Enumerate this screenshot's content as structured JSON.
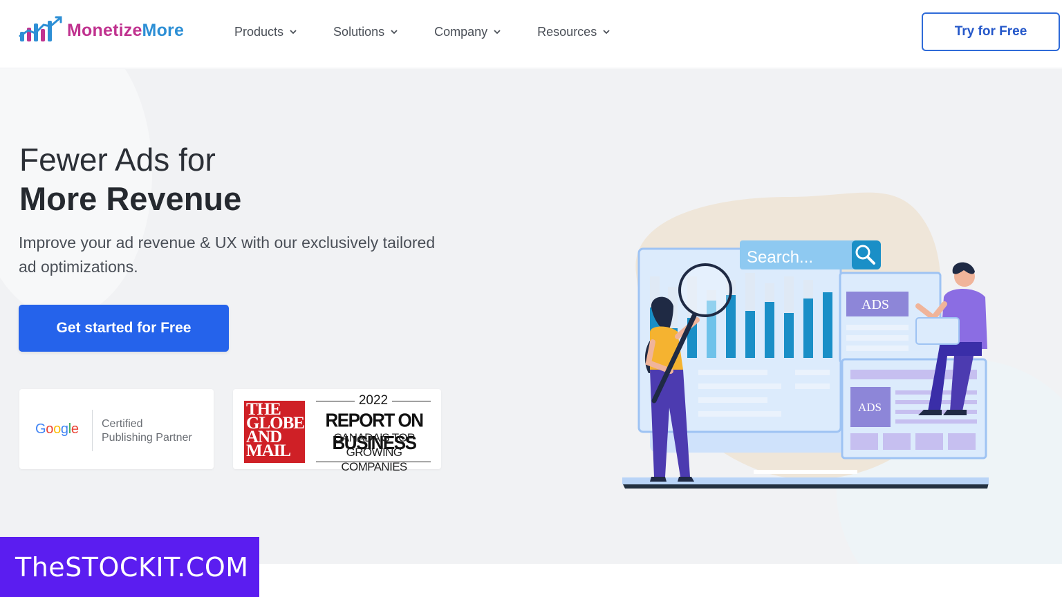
{
  "header": {
    "logo_text_a": "Monetize",
    "logo_text_b": "More",
    "nav": [
      {
        "label": "Products"
      },
      {
        "label": "Solutions"
      },
      {
        "label": "Company"
      },
      {
        "label": "Resources"
      }
    ],
    "cta_label": "Try for Free"
  },
  "hero": {
    "title_line1": "Fewer Ads for",
    "title_line2": "More Revenue",
    "subtitle": "Improve your ad revenue & UX with our exclusively tailored ad optimizations.",
    "cta_label": "Get started for Free"
  },
  "badges": {
    "google": {
      "brand": "Google",
      "line1": "Certified",
      "line2": "Publishing Partner"
    },
    "globe": {
      "box_lines": [
        "THE",
        "GLOBE",
        "AND",
        "MAIL"
      ],
      "year": "2022",
      "title": "REPORT ON BUSINESS",
      "sub1": "CANADA'S TOP GROWING",
      "sub2": "COMPANIES"
    }
  },
  "illustration": {
    "search_text": "Search...",
    "ads_label_1": "ADS",
    "ads_label_2": "ADS"
  },
  "watermark": {
    "text": "TheSTOCKIT.COM"
  },
  "colors": {
    "primary": "#2563eb",
    "logo_blue": "#2d8fd5",
    "logo_magenta": "#c0328f",
    "hero_bg": "#f1f2f4",
    "watermark": "#5b1df0"
  }
}
